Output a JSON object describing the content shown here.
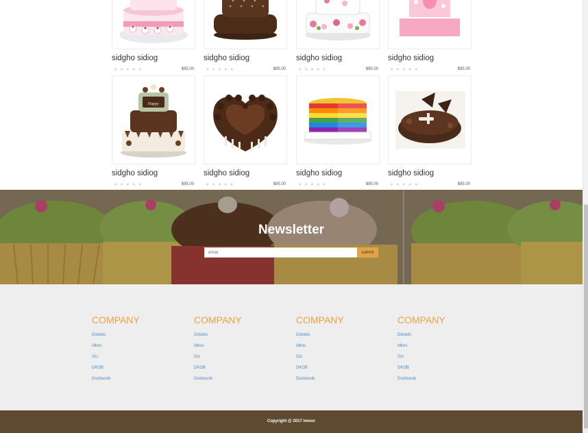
{
  "products": [
    {
      "name": "sidgho sidiog",
      "price": "$95.00",
      "rating": 0,
      "image": "hello-kitty-cake"
    },
    {
      "name": "sidgho sidiog",
      "price": "$95.00",
      "rating": 0,
      "image": "chocolate-dot-cake"
    },
    {
      "name": "sidgho sidiog",
      "price": "$95.00",
      "rating": 0,
      "image": "floral-tier-cake"
    },
    {
      "name": "sidgho sidiog",
      "price": "$95.00",
      "rating": 0,
      "image": "pink-bear-cake"
    },
    {
      "name": "sidgho sidiog",
      "price": "$95.00",
      "rating": 0,
      "image": "happy-birthday-tier-cake"
    },
    {
      "name": "sidgho sidiog",
      "price": "$95.00",
      "rating": 0,
      "image": "chocolate-heart-cake"
    },
    {
      "name": "sidgho sidiog",
      "price": "$95.00",
      "rating": 0,
      "image": "rainbow-cake"
    },
    {
      "name": "sidgho sidiog",
      "price": "$95.00",
      "rating": 0,
      "image": "chocolate-cream-cake"
    }
  ],
  "newsletter": {
    "title": "Newsletter",
    "email_placeholder": "email",
    "submit_label": "submit",
    "background": "cupcakes-photo"
  },
  "footer": {
    "columns": [
      {
        "title": "COMPANY",
        "links": [
          "Ddsbds",
          "Idkos",
          "Oci",
          "DKOB",
          "Dscbooob"
        ]
      },
      {
        "title": "COMPANY",
        "links": [
          "Ddsbds",
          "Idkos",
          "Oci",
          "DKOB",
          "Dscbooob"
        ]
      },
      {
        "title": "COMPANY",
        "links": [
          "Ddsbds",
          "Idkos",
          "Oci",
          "DKOB",
          "Dscbooob"
        ]
      },
      {
        "title": "COMPANY",
        "links": [
          "Ddsbds",
          "Idkos",
          "Oci",
          "DKOB",
          "Dscbooob"
        ]
      }
    ],
    "copyright": "Copyright @ 2017 imooc"
  },
  "colors": {
    "accent": "#f0a040",
    "submit": "#e0a24a",
    "link": "#4a8ac0",
    "footer_bg": "#eeeeee",
    "copyright_bg": "#5d4a31"
  }
}
